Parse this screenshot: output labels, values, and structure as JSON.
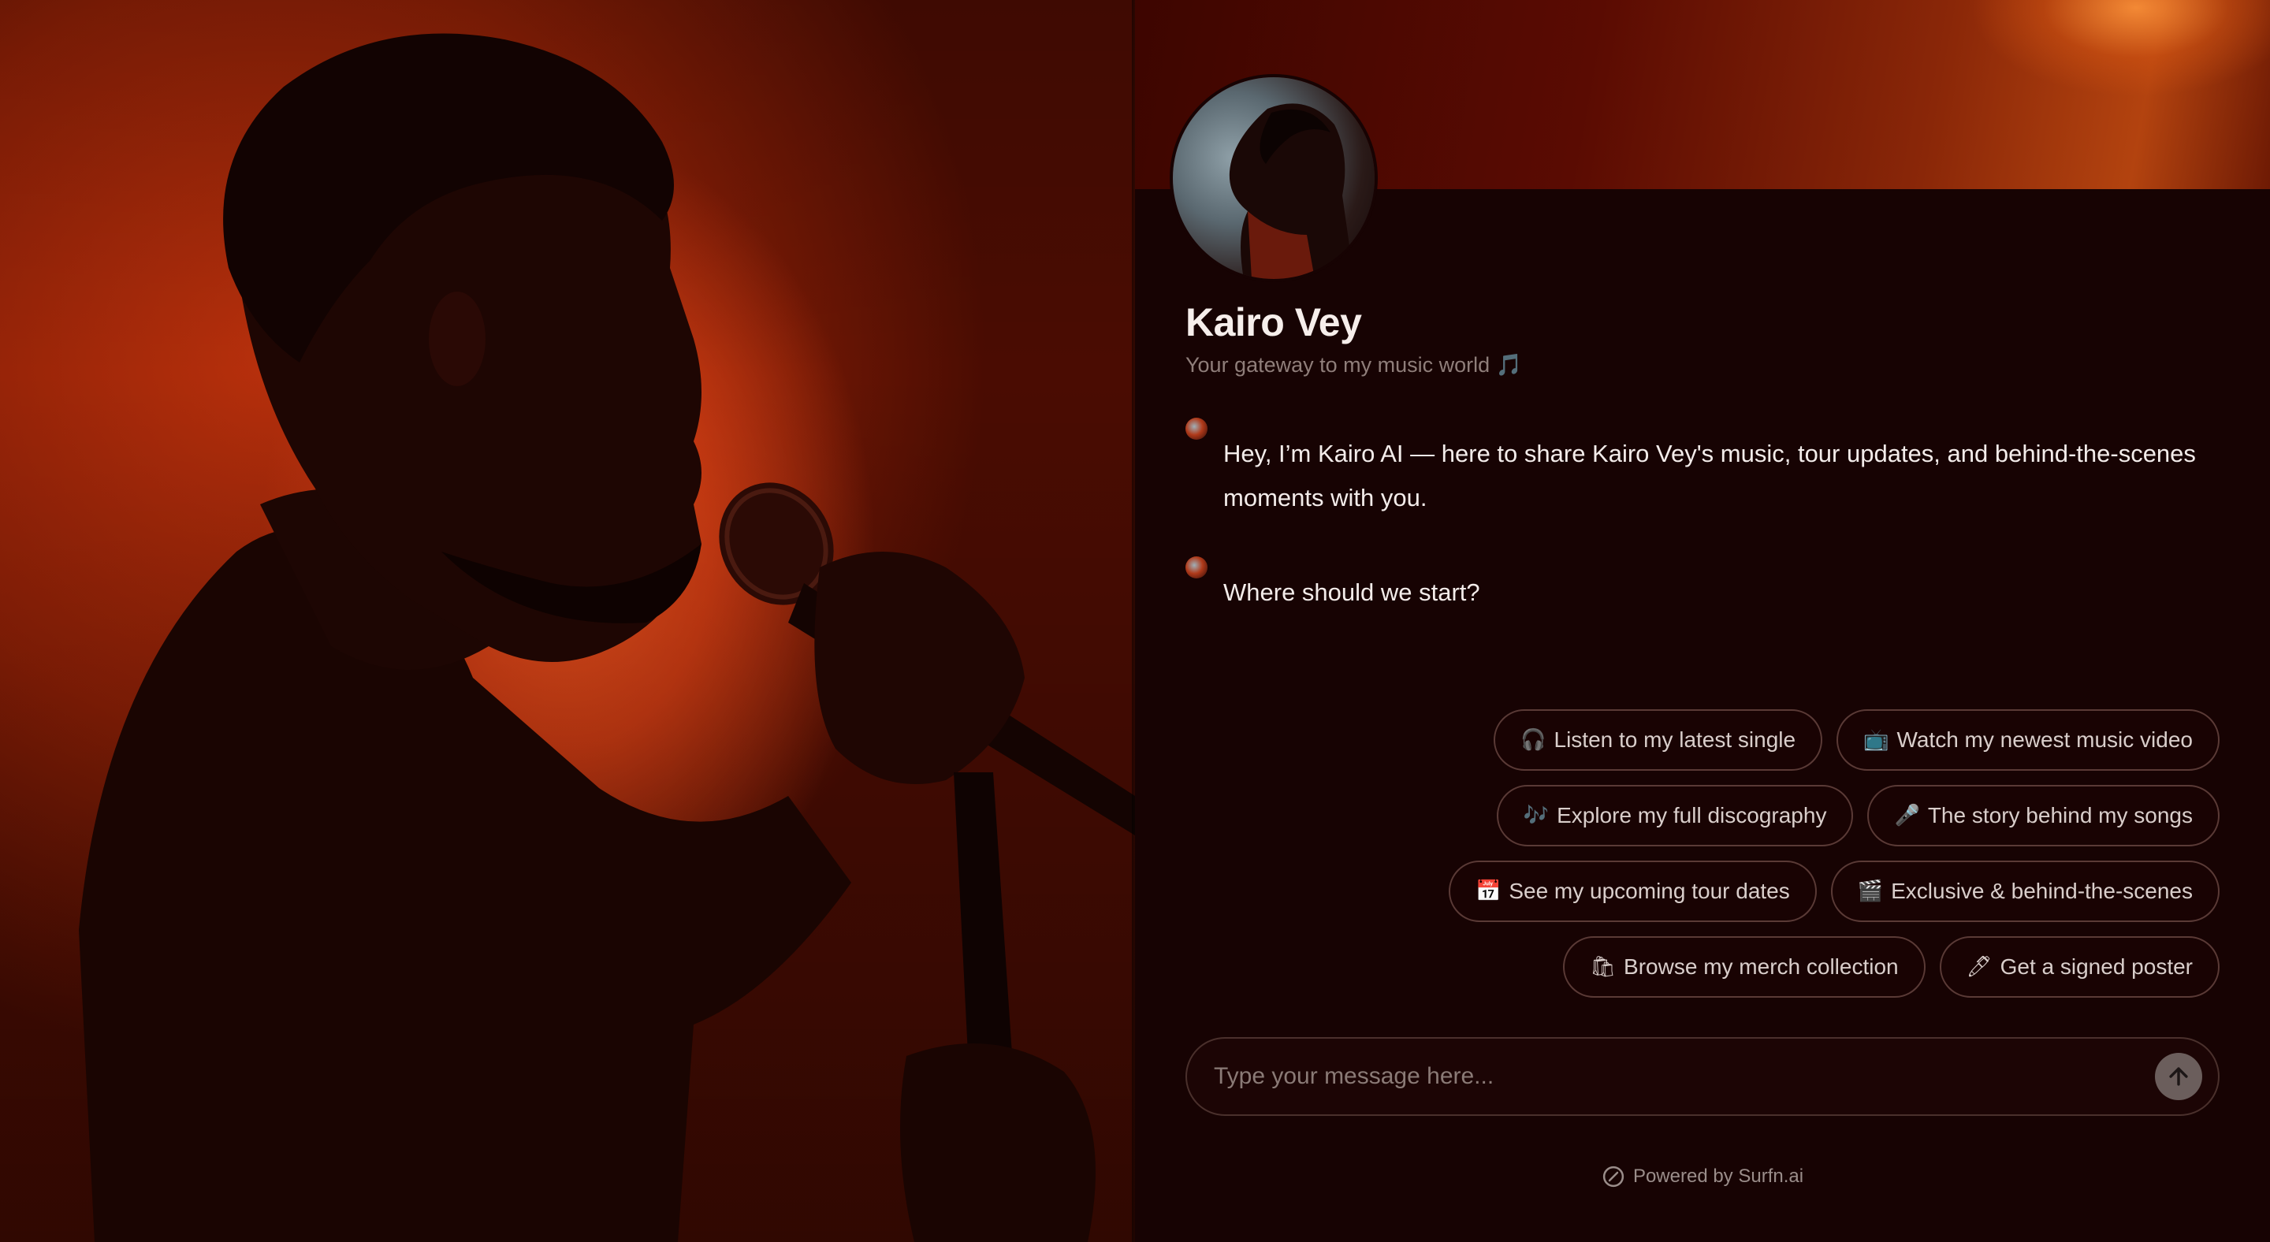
{
  "profile": {
    "name": "Kairo Vey",
    "tagline": "Your gateway to my music world 🎵"
  },
  "messages": [
    {
      "text": "Hey, I’m Kairo AI — here to share Kairo Vey's music, tour updates, and behind-the-scenes moments with you."
    },
    {
      "text": "Where should we start?"
    }
  ],
  "suggestions": {
    "row1": [
      {
        "emoji": "🎧",
        "label": "Listen to my latest single"
      },
      {
        "emoji": "📺",
        "label": "Watch my newest music video"
      }
    ],
    "row2": [
      {
        "emoji": "🎶",
        "label": "Explore my full discography"
      },
      {
        "emoji": "🎤",
        "label": "The story behind my songs"
      }
    ],
    "row3": [
      {
        "emoji": "📅",
        "label": "See my upcoming tour dates"
      },
      {
        "emoji": "🎬",
        "label": "Exclusive & behind-the-scenes"
      }
    ],
    "row4": [
      {
        "emoji": "🛍",
        "label": "Browse my merch collection"
      },
      {
        "emoji": "🖊",
        "label": "Get a signed poster"
      }
    ]
  },
  "composer": {
    "placeholder": "Type your message here..."
  },
  "footer": {
    "powered_by": "Powered by Surfn.ai"
  },
  "icons": {
    "send": "arrow-up-icon",
    "powered": "surfn-logo-icon"
  },
  "colors": {
    "panel_bg": "#170303",
    "accent": "#c33a12",
    "chip_border": "#5a3a36",
    "send_button": "#6b5e5c"
  }
}
